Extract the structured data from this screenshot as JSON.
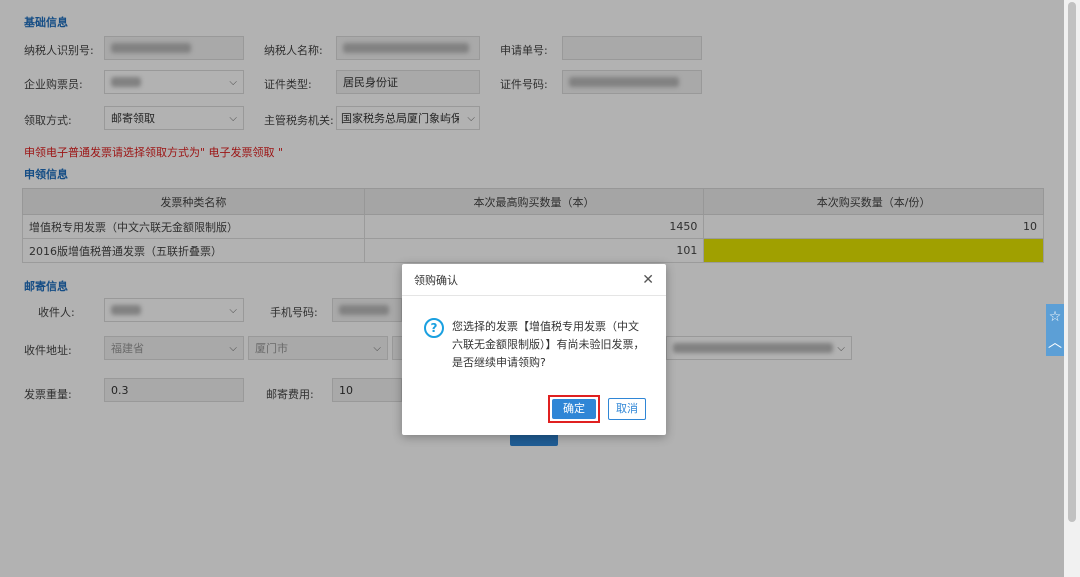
{
  "basic": {
    "section_title": "基础信息",
    "taxpayer_id_label": "纳税人识别号:",
    "taxpayer_name_label": "纳税人名称:",
    "application_no_label": "申请单号:",
    "buyer_label": "企业购票员:",
    "cert_type_label": "证件类型:",
    "cert_type_value": "居民身份证",
    "cert_no_label": "证件号码:",
    "pickup_label": "领取方式:",
    "pickup_value": "邮寄领取",
    "tax_office_label": "主管税务机关:",
    "tax_office_value": "国家税务总局厦门象屿保税"
  },
  "note": "申领电子普通发票请选择领取方式为\" 电子发票领取 \"",
  "apply": {
    "section_title": "申领信息",
    "columns": [
      "发票种类名称",
      "本次最高购买数量（本）",
      "本次购买数量（本/份）"
    ],
    "rows": [
      {
        "name": "增值税专用发票（中文六联无金额限制版）",
        "max": "1450",
        "qty": "10"
      },
      {
        "name": "2016版增值税普通发票（五联折叠票）",
        "max": "101",
        "qty": ""
      }
    ]
  },
  "mail": {
    "section_title": "邮寄信息",
    "recipient_label": "收件人:",
    "phone_label": "手机号码:",
    "address_label": "收件地址:",
    "province": "福建省",
    "city": "厦门市",
    "weight_label": "发票重量:",
    "weight_value": "0.3",
    "fee_label": "邮寄费用:",
    "fee_value": "10"
  },
  "dialog": {
    "title": "领购确认",
    "message": "您选择的发票【增值税专用发票（中文六联无金额限制版）】有尚未验旧发票，是否继续申请领购?",
    "ok": "确定",
    "cancel": "取消"
  },
  "icons": {
    "star": "☆",
    "up": "︿",
    "close": "✕",
    "chevron": "⌵"
  },
  "colors": {
    "accent": "#2f86d6",
    "highlight": "#e6e600",
    "warning": "#e02020"
  }
}
